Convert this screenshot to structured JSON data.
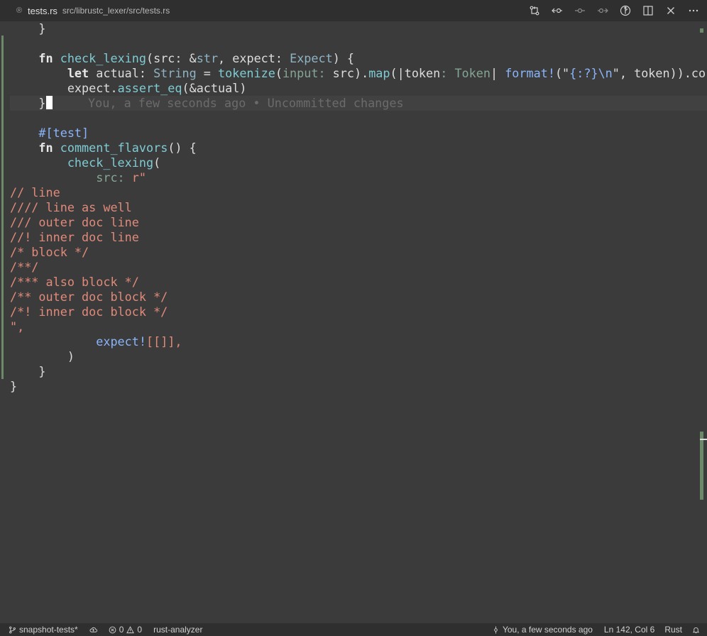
{
  "tab": {
    "title": "tests.rs",
    "path": "src/librustc_lexer/src/tests.rs"
  },
  "actions": [
    {
      "name": "open-changes-icon"
    },
    {
      "name": "go-back-icon"
    },
    {
      "name": "timeline-dot-icon"
    },
    {
      "name": "go-forward-icon"
    },
    {
      "name": "source-control-graph-icon"
    },
    {
      "name": "split-editor-icon"
    },
    {
      "name": "close-icon"
    },
    {
      "name": "more-actions-icon"
    }
  ],
  "code": {
    "l1": "    }",
    "l3_indent": "    ",
    "l3_kw": "fn",
    "l3_name": "check_lexing",
    "l3_p1": "(src: &",
    "l3_ty1": "str",
    "l3_p2": ", expect: ",
    "l3_ty2": "Expect",
    "l3_p3": ") {",
    "l4_indent": "        ",
    "l4_kw": "let",
    "l4_a": " actual: ",
    "l4_ty": "String",
    "l4_b": " = ",
    "l4_fn": "tokenize",
    "l4_c": "(",
    "l4_hint1": "input:",
    "l4_d": " src).",
    "l4_map": "map",
    "l4_e": "(|token",
    "l4_hint2": ": Token",
    "l4_f": "| ",
    "l4_mac": "format!",
    "l4_g": "(\"",
    "l4_fmt": "{:?}\\n",
    "l4_h": "\", token)).co",
    "l5_indent": "        ",
    "l5_a": "expect.",
    "l5_meth": "assert_eq",
    "l5_b": "(&actual)",
    "l6_indent": "    ",
    "l6_brace": "}",
    "blame": "     You, a few seconds ago • Uncommitted changes",
    "l8": "    #[test]",
    "l9_indent": "    ",
    "l9_kw": "fn",
    "l9_name": "comment_flavors",
    "l9_p": "() {",
    "l10_indent": "        ",
    "l10_fn": "check_lexing",
    "l10_p": "(",
    "l11_indent": "            ",
    "l11_hint": "src:",
    "l11_str": " r\"",
    "s1": "// line",
    "s2": "//// line as well",
    "s3": "/// outer doc line",
    "s4": "//! inner doc line",
    "s5": "/* block */",
    "s6": "/**/",
    "s7": "/*** also block */",
    "s8": "/** outer doc block */",
    "s9": "/*! inner doc block */",
    "s10": "\",",
    "l22_indent": "            ",
    "l22_mac": "expect!",
    "l22_p": "[[]],",
    "l23": "        )",
    "l24": "    }",
    "l25": "}"
  },
  "status": {
    "branch": "snapshot-tests*",
    "errors": "0",
    "warnings": "0",
    "language_server": "rust-analyzer",
    "blame": "You, a few seconds ago",
    "position": "Ln 142, Col 6",
    "language": "Rust"
  }
}
